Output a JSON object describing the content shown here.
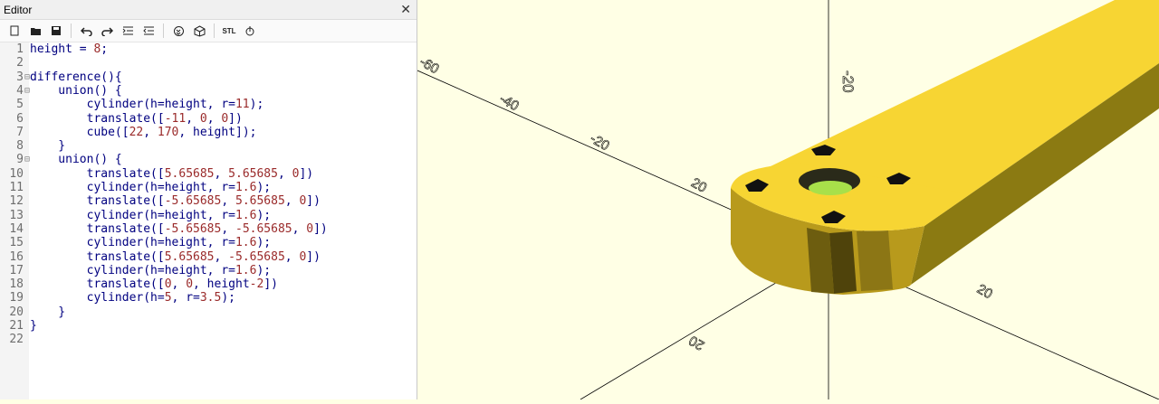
{
  "editor": {
    "title": "Editor",
    "close_label": "✕",
    "toolbar": {
      "new_icon": "new-file-icon",
      "open_icon": "open-folder-icon",
      "save_icon": "save-icon",
      "undo_icon": "undo-icon",
      "redo_icon": "redo-icon",
      "indent_icon": "indent-icon",
      "unindent_icon": "unindent-icon",
      "preview_icon": "preview-icon",
      "render_icon": "render-icon",
      "stl_label": "STL",
      "send_icon": "send-icon"
    },
    "lines": [
      {
        "n": "1",
        "fold": "",
        "text": "height = 8;"
      },
      {
        "n": "2",
        "fold": "",
        "text": ""
      },
      {
        "n": "3",
        "fold": "⊟",
        "text": "difference(){"
      },
      {
        "n": "4",
        "fold": "⊟",
        "text": "    union() {"
      },
      {
        "n": "5",
        "fold": "",
        "text": "        cylinder(h=height, r=11);"
      },
      {
        "n": "6",
        "fold": "",
        "text": "        translate([-11, 0, 0])"
      },
      {
        "n": "7",
        "fold": "",
        "text": "        cube([22, 170, height]);"
      },
      {
        "n": "8",
        "fold": "",
        "text": "    }"
      },
      {
        "n": "9",
        "fold": "⊟",
        "text": "    union() {"
      },
      {
        "n": "10",
        "fold": "",
        "text": "        translate([5.65685, 5.65685, 0])"
      },
      {
        "n": "11",
        "fold": "",
        "text": "        cylinder(h=height, r=1.6);"
      },
      {
        "n": "12",
        "fold": "",
        "text": "        translate([-5.65685, 5.65685, 0])"
      },
      {
        "n": "13",
        "fold": "",
        "text": "        cylinder(h=height, r=1.6);"
      },
      {
        "n": "14",
        "fold": "",
        "text": "        translate([-5.65685, -5.65685, 0])"
      },
      {
        "n": "15",
        "fold": "",
        "text": "        cylinder(h=height, r=1.6);"
      },
      {
        "n": "16",
        "fold": "",
        "text": "        translate([5.65685, -5.65685, 0])"
      },
      {
        "n": "17",
        "fold": "",
        "text": "        cylinder(h=height, r=1.6);"
      },
      {
        "n": "18",
        "fold": "",
        "text": "        translate([0, 0, height-2])"
      },
      {
        "n": "19",
        "fold": "",
        "text": "        cylinder(h=5, r=3.5);"
      },
      {
        "n": "20",
        "fold": "",
        "text": "    }"
      },
      {
        "n": "21",
        "fold": "",
        "text": "}"
      },
      {
        "n": "22",
        "fold": "",
        "text": ""
      }
    ]
  },
  "viewport": {
    "background": "#ffffe5",
    "model_color": "#f7d533",
    "axis_labels": [
      "-60",
      "-40",
      "-20",
      "20",
      "-20",
      "20",
      "20"
    ]
  }
}
